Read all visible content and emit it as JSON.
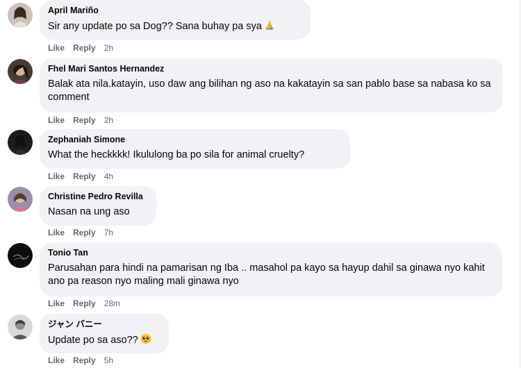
{
  "comments": [
    {
      "author": "April Mariño",
      "text": "Sir any update po sa Dog?? Sana buhay pa sya",
      "emoji": "folded-hands-icon",
      "like": "Like",
      "reply": "Reply",
      "time": "2h"
    },
    {
      "author": "Fhel Mari Santos Hernandez",
      "text": "Balak ata nila.katayin, uso daw ang bilihan ng aso na kakatayin sa san pablo base sa nabasa ko sa comment",
      "like": "Like",
      "reply": "Reply",
      "time": "2h"
    },
    {
      "author": "Zephaniah Simone",
      "text": "What the heckkkk! Ikululong ba po sila for animal cruelty?",
      "like": "Like",
      "reply": "Reply",
      "time": "4h"
    },
    {
      "author": "Christine Pedro Revilla",
      "text": "Nasan na ung aso",
      "like": "Like",
      "reply": "Reply",
      "time": "7h"
    },
    {
      "author": "Tonio Tan",
      "text": "Parusahan para hindi na pamarisan ng Iba .. masahol pa kayo sa hayup dahil sa ginawa nyo kahit ano pa reason nyo maling mali ginawa nyo",
      "like": "Like",
      "reply": "Reply",
      "time": "28m"
    },
    {
      "author": "ジャン バニー",
      "text": "Update po sa aso??",
      "emoji": "pleading-face-icon",
      "like": "Like",
      "reply": "Reply",
      "time": "5h"
    }
  ]
}
